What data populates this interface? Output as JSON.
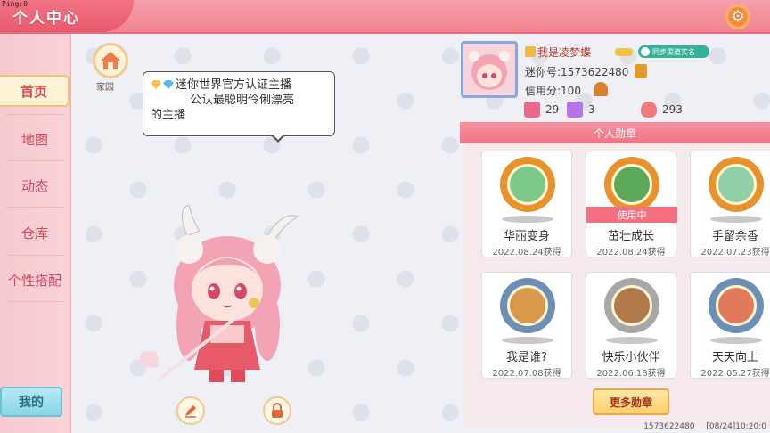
{
  "status": {
    "ping": "Ping:0"
  },
  "header": {
    "title": "个人中心",
    "settings_icon": "gear-icon"
  },
  "nav": {
    "items": [
      {
        "label": "首页",
        "active": true
      },
      {
        "label": "地图",
        "active": false
      },
      {
        "label": "动态",
        "active": false
      },
      {
        "label": "仓库",
        "active": false
      },
      {
        "label": "个性搭配",
        "active": false
      }
    ],
    "mine_label": "我的"
  },
  "home": {
    "label": "家园",
    "icon": "house-icon"
  },
  "bubble": {
    "line1": "迷你世界官方认证主播",
    "line2": "公认最聪明伶俐漂亮",
    "line3": "的主播"
  },
  "profile": {
    "name": "我是凌梦蝶",
    "sync_label": "同步渠道实名",
    "mini_id": "迷你号:1573622480",
    "credit": "信用分:100",
    "stats": [
      {
        "icon": "heart-book-icon",
        "value": "29",
        "color": "#e86a8a"
      },
      {
        "icon": "crown-icon",
        "value": "3",
        "color": "#b774e8"
      },
      {
        "icon": "flame-icon",
        "value": "293",
        "color": "#f07a7a"
      }
    ]
  },
  "badges": {
    "header": "个人勋章",
    "in_use_label": "使用中",
    "items": [
      {
        "name": "华丽变身",
        "date": "2022.08.24获得",
        "ring": "#e8922e",
        "fill": "#7bc98a",
        "in_use": false
      },
      {
        "name": "茁壮成长",
        "date": "2022.08.24获得",
        "ring": "#e8922e",
        "fill": "#5ba85a",
        "in_use": true
      },
      {
        "name": "手留余香",
        "date": "2022.07.23获得",
        "ring": "#e8922e",
        "fill": "#8fd0a6",
        "in_use": false
      },
      {
        "name": "我是谁?",
        "date": "2022.07.08获得",
        "ring": "#6c8fb6",
        "fill": "#d89a4a",
        "in_use": false
      },
      {
        "name": "快乐小伙伴",
        "date": "2022.06.18获得",
        "ring": "#a7a7a7",
        "fill": "#b07a4a",
        "in_use": false
      },
      {
        "name": "天天向上",
        "date": "2022.05.27获得",
        "ring": "#6c8fb6",
        "fill": "#e07a5a",
        "in_use": false
      }
    ],
    "more_label": "更多勋章"
  },
  "footer": {
    "id": "1573622480",
    "time": "[08/24]10:20:0"
  }
}
